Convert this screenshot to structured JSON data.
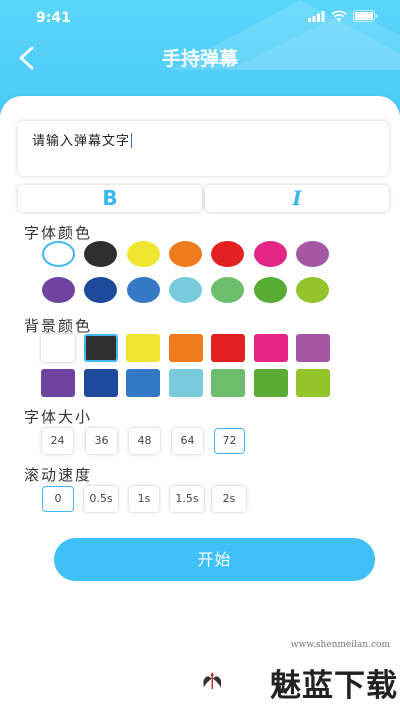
{
  "status": {
    "time": "9:41"
  },
  "nav": {
    "title": "手持弹幕",
    "back_icon": "chevron-left-icon"
  },
  "input": {
    "value": "请输入弹幕文字"
  },
  "style_buttons": {
    "bold": "B",
    "italic": "I"
  },
  "font_color": {
    "label": "字体颜色",
    "selected_index": 0,
    "swatches": [
      "#ffffff",
      "#2f2f2f",
      "#efe632",
      "#ee7c1e",
      "#e32120",
      "#e42585",
      "#a458a4",
      "#6f43a0",
      "#1d4a9b",
      "#3478c6",
      "#79cbdc",
      "#6cbd6c",
      "#59ad33",
      "#93c42a"
    ]
  },
  "bg_color": {
    "label": "背景颜色",
    "selected_index": 1,
    "swatches": [
      "#ffffff",
      "#2f2f2f",
      "#efe632",
      "#ee7c1e",
      "#e32120",
      "#e42585",
      "#a458a4",
      "#6f43a0",
      "#1d4a9b",
      "#3478c6",
      "#79cbdc",
      "#6cbd6c",
      "#59ad33",
      "#93c42a"
    ]
  },
  "font_size": {
    "label": "字体大小",
    "options": [
      "24",
      "36",
      "48",
      "64",
      "72"
    ],
    "selected_index": 4
  },
  "scroll_speed": {
    "label": "滚动速度",
    "options": [
      "0",
      "0.5s",
      "1s",
      "1.5s",
      "2s"
    ],
    "selected_index": 0
  },
  "start_button": {
    "label": "开始"
  },
  "watermark": {
    "url": "www.shenmeilan.com",
    "text": "魅蓝下载"
  }
}
